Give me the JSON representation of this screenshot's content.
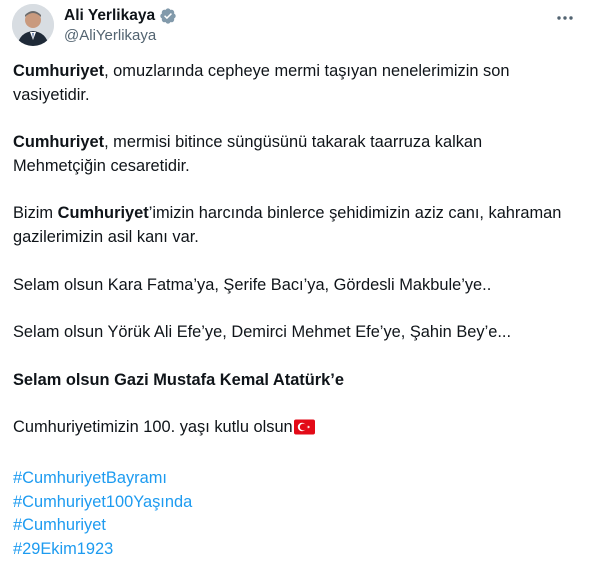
{
  "author": {
    "name": "Ali Yerlikaya",
    "handle": "@AliYerlikaya",
    "verified_icon": "verified-badge-icon",
    "badge_color": "#829aab"
  },
  "menu_icon": "more-horizontal-icon",
  "tweet": {
    "p1": {
      "bold": "Cumhuriyet",
      "rest": ", omuzlarında cepheye mermi taşıyan nenelerimizin son vasiyetidir."
    },
    "p2": {
      "bold": "Cumhuriyet",
      "rest": ", mermisi bitince süngüsünü takarak taarruza kalkan Mehmetçiğin cesaretidir."
    },
    "p3": {
      "pre": "Bizim ",
      "bold": "Cumhuriyet",
      "rest": "’imizin harcında binlerce şehidimizin aziz canı, kahraman gazilerimizin asil kanı var."
    },
    "p4": "Selam olsun Kara Fatma’ya, Şerife Bacı’ya, Gördesli Makbule’ye..",
    "p5": "Selam olsun Yörük Ali Efe’ye, Demirci Mehmet Efe’ye, Şahin Bey’e...",
    "p6": "Selam olsun Gazi Mustafa Kemal Atatürk’e",
    "p7": "Cumhuriyetimizin 100. yaşı kutlu olsun",
    "flag_icon": "turkey-flag-icon",
    "hashtags": [
      "#CumhuriyetBayramı",
      "#Cumhuriyet100Yaşında",
      "#Cumhuriyet",
      "#29Ekim1923"
    ]
  },
  "colors": {
    "text": "#0f1419",
    "secondary": "#536471",
    "link": "#1d9bf0",
    "flag": "#e30a17"
  }
}
